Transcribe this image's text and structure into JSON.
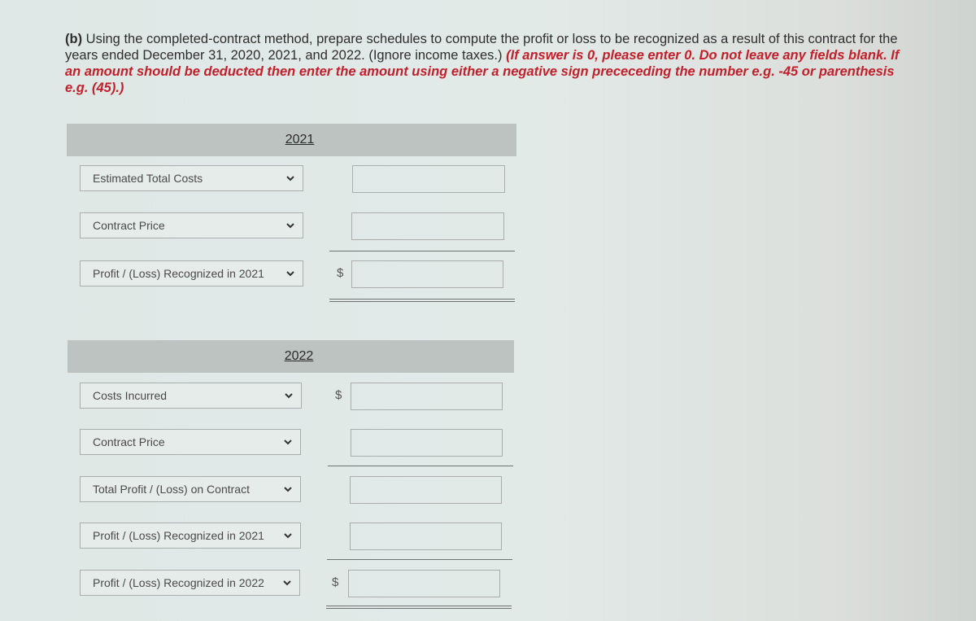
{
  "question": {
    "part_label": "(b)",
    "text": "Using the completed-contract method, prepare schedules to compute the profit or loss to be recognized as a result of this contract for the years ended December 31, 2020, 2021, and 2022. (Ignore income taxes.)",
    "instruction": "(If answer is 0, please enter 0. Do not leave any fields blank. If an amount should be deducted then enter the amount using either a negative sign prececeding the number e.g. -45 or parenthesis e.g. (45).)"
  },
  "sections": [
    {
      "year": "2021",
      "rows": [
        {
          "label": "Estimated Total Costs",
          "dollar": "",
          "value": ""
        },
        {
          "label": "Contract Price",
          "dollar": "",
          "value": ""
        },
        {
          "label": "Profit / (Loss) Recognized in 2021",
          "dollar": "$",
          "value": ""
        }
      ]
    },
    {
      "year": "2022",
      "rows": [
        {
          "label": "Costs Incurred",
          "dollar": "$",
          "value": ""
        },
        {
          "label": "Contract Price",
          "dollar": "",
          "value": ""
        },
        {
          "label": "Total Profit / (Loss) on Contract",
          "dollar": "",
          "value": ""
        },
        {
          "label": "Profit / (Loss) Recognized in 2021",
          "dollar": "",
          "value": ""
        },
        {
          "label": "Profit / (Loss) Recognized in 2022",
          "dollar": "$",
          "value": ""
        }
      ]
    }
  ],
  "icons": {
    "dropdown": "chevron-down-icon"
  },
  "colors": {
    "instruction_red": "#c21f2a",
    "header_bar": "#bcc3c1"
  }
}
